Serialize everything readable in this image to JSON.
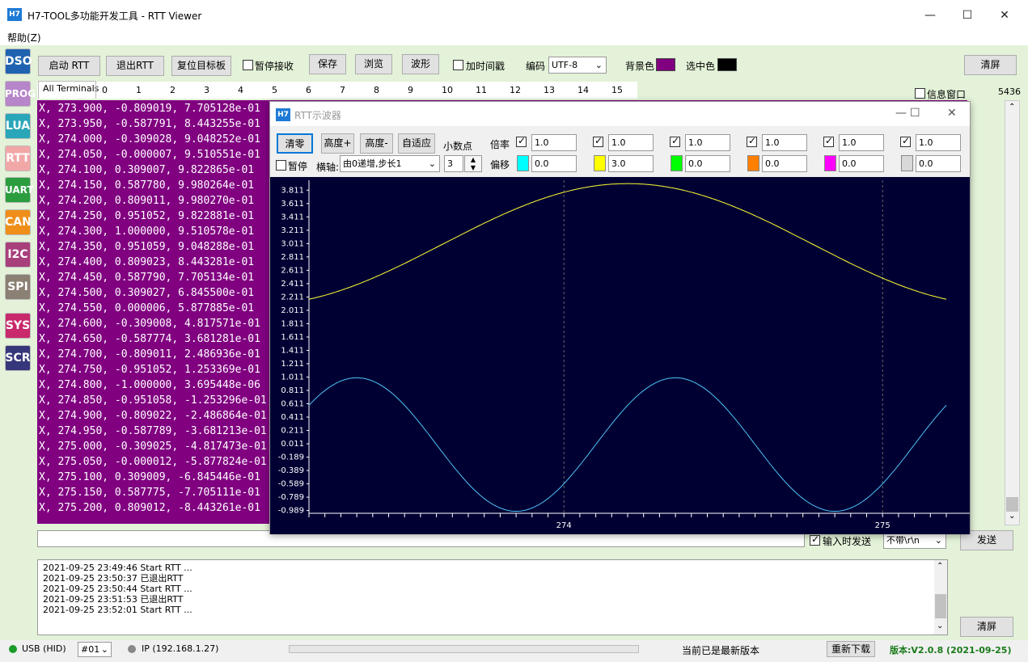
{
  "window": {
    "title": "H7-TOOL多功能开发工具 - RTT Viewer",
    "icon_label": "H7",
    "minimize": "—",
    "maximize": "☐",
    "close": "✕"
  },
  "menu": {
    "help": "帮助(Z)"
  },
  "sidebar": [
    {
      "label": "DSO",
      "color": "#1f63b0"
    },
    {
      "label": "PROG",
      "color": "#b785c9"
    },
    {
      "label": "LUA",
      "color": "#2aa6b9"
    },
    {
      "label": "RTT",
      "color": "#f2a7a7"
    },
    {
      "label": "UART",
      "color": "#2c9d3e"
    },
    {
      "label": "CAN",
      "color": "#ef8e19"
    },
    {
      "label": "I2C",
      "color": "#a8407c"
    },
    {
      "label": "SPI",
      "color": "#8a8073"
    },
    {
      "label": "SYS",
      "color": "#c82a6b"
    },
    {
      "label": "SCR",
      "color": "#36377a"
    }
  ],
  "toolbar": {
    "start_rtt": "启动 RTT",
    "exit_rtt": "退出RTT",
    "reset_target": "复位目标板",
    "pause_receive": "暂停接收",
    "save": "保存",
    "browse": "浏览",
    "waveform": "波形",
    "add_timestamp": "加时间戳",
    "encoding_label": "编码",
    "encoding_value": "UTF-8",
    "bg_color_label": "背景色",
    "bg_color": "#800080",
    "sel_color_label": "选中色",
    "sel_color": "#000000",
    "clear": "清屏"
  },
  "tabs": [
    "All Terminals",
    "0",
    "1",
    "2",
    "3",
    "4",
    "5",
    "6",
    "7",
    "8",
    "9",
    "10",
    "11",
    "12",
    "13",
    "14",
    "15"
  ],
  "info_window": "信息窗口",
  "counter": "5436",
  "terminal_lines": [
    "X, 273.900, -0.809019, 7.705128e-01",
    "X, 273.950, -0.587791, 8.443255e-01",
    "X, 274.000, -0.309028, 9.048252e-01",
    "X, 274.050, -0.000007, 9.510551e-01",
    "X, 274.100, 0.309007, 9.822865e-01",
    "X, 274.150, 0.587780, 9.980264e-01",
    "X, 274.200, 0.809011, 9.980270e-01",
    "X, 274.250, 0.951052, 9.822881e-01",
    "X, 274.300, 1.000000, 9.510578e-01",
    "X, 274.350, 0.951059, 9.048288e-01",
    "X, 274.400, 0.809023, 8.443281e-01",
    "X, 274.450, 0.587790, 7.705134e-01",
    "X, 274.500, 0.309027, 6.845500e-01",
    "X, 274.550, 0.000006, 5.877885e-01",
    "X, 274.600, -0.309008, 4.817571e-01",
    "X, 274.650, -0.587774, 3.681281e-01",
    "X, 274.700, -0.809011, 2.486936e-01",
    "X, 274.750, -0.951052, 1.253369e-01",
    "X, 274.800, -1.000000, 3.695448e-06",
    "X, 274.850, -0.951058, -1.253296e-01",
    "X, 274.900, -0.809022, -2.486864e-01",
    "X, 274.950, -0.587789, -3.681213e-01",
    "X, 275.000, -0.309025, -4.817473e-01",
    "X, 275.050, -0.000012, -5.877824e-01",
    "X, 275.100, 0.309009, -6.845446e-01",
    "X, 275.150, 0.587775, -7.705111e-01",
    "X, 275.200, 0.809012, -8.443261e-01"
  ],
  "send_row": {
    "send_on_input": "输入时发送",
    "line_ending": "不带\\r\\n",
    "send": "发送"
  },
  "log_lines": [
    "2021-09-25 23:49:46 Start RTT ...",
    "2021-09-25 23:50:37 已退出RTT",
    "2021-09-25 23:50:44 Start RTT ...",
    "2021-09-25 23:51:53 已退出RTT",
    "2021-09-25 23:52:01 Start RTT ..."
  ],
  "log_clear": "清屏",
  "status": {
    "usb": "USB (HID)",
    "usb_color": "#1a9b2a",
    "device": "#01",
    "ip": "IP (192.168.1.27)",
    "ip_color": "#888888",
    "update_msg": "当前已是最新版本",
    "redownload": "重新下载",
    "version": "版本:V2.0.8 (2021-09-25)",
    "version_color": "#1a7a1a"
  },
  "scope": {
    "title": "RTT示波器",
    "icon_label": "H7",
    "clear": "清零",
    "height_plus": "高度+",
    "height_minus": "高度-",
    "auto_fit": "自适应",
    "decimals_label": "小数点",
    "decimals_value": "3",
    "pause": "暂停",
    "xaxis_label": "横轴:",
    "xaxis_value": "由0递增,步长1",
    "gain_label": "倍率",
    "offset_label": "偏移",
    "channels": [
      {
        "gain": "1.0",
        "offset": "0.0",
        "color": "#00ffff"
      },
      {
        "gain": "1.0",
        "offset": "3.0",
        "color": "#ffff00"
      },
      {
        "gain": "1.0",
        "offset": "0.0",
        "color": "#00ff00"
      },
      {
        "gain": "1.0",
        "offset": "0.0",
        "color": "#ff8000"
      },
      {
        "gain": "1.0",
        "offset": "0.0",
        "color": "#ff00ff"
      },
      {
        "gain": "1.0",
        "offset": "0.0",
        "color": "#d8d8d8"
      }
    ]
  },
  "chart_data": {
    "type": "line",
    "title": "",
    "xlabel": "",
    "ylabel": "",
    "xlim": [
      273.2,
      275.2
    ],
    "ylim": [
      -1.03,
      3.96
    ],
    "x_ticks": [
      274,
      275
    ],
    "y_ticks": [
      "3.811",
      "3.611",
      "3.411",
      "3.211",
      "3.011",
      "2.811",
      "2.611",
      "2.411",
      "2.211",
      "2.011",
      "1.811",
      "1.611",
      "1.411",
      "1.211",
      "1.011",
      "0.811",
      "0.611",
      "0.411",
      "0.211",
      "0.011",
      "-0.189",
      "-0.389",
      "-0.589",
      "-0.789",
      "-0.989"
    ],
    "background": "#000033",
    "grid": true,
    "series": [
      {
        "color": "#4fc3f7",
        "x_start": 273.2,
        "x_end": 275.2,
        "period": 1.0,
        "x": [
          273.2,
          273.4,
          273.6,
          273.8,
          274.0,
          274.2,
          274.4,
          274.6,
          274.8,
          275.0,
          275.2
        ],
        "values": [
          0.588,
          0.951,
          0.0,
          -0.951,
          -0.588,
          0.588,
          0.951,
          0.0,
          -0.951,
          -0.588,
          0.809
        ]
      },
      {
        "color": "#ffff33",
        "x": [
          273.2,
          273.6,
          274.0,
          274.4,
          274.6,
          274.8,
          275.2
        ],
        "values": [
          2.16,
          2.55,
          3.9,
          3.84,
          3.57,
          3.0,
          2.16
        ]
      }
    ]
  }
}
